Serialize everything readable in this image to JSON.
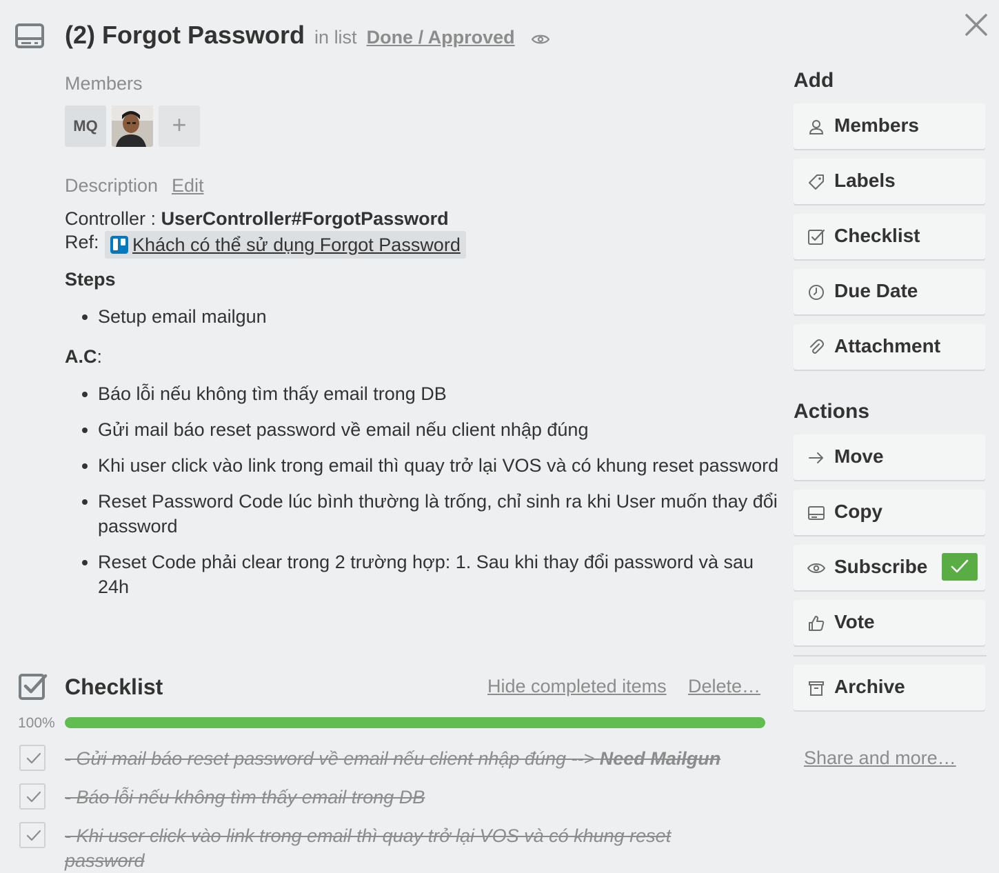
{
  "header": {
    "title": "(2) Forgot Password",
    "in_list_text": "in list",
    "list_name": "Done / Approved"
  },
  "members": {
    "label": "Members",
    "avatars": [
      {
        "initials": "MQ"
      },
      {
        "initials": ""
      }
    ],
    "add_symbol": "+"
  },
  "description": {
    "label": "Description",
    "edit_label": "Edit",
    "controller_prefix": "Controller : ",
    "controller_value": "UserController#ForgotPassword",
    "ref_prefix": "Ref:",
    "ref_link": "Khách có thể sử dụng Forgot Password",
    "steps_heading": "Steps",
    "steps": [
      "Setup email mailgun"
    ],
    "ac_heading": "A.C",
    "ac_colon": ":",
    "ac_items": [
      "Báo lỗi nếu không tìm thấy email trong DB",
      "Gửi mail báo reset password về email nếu client nhập đúng",
      "Khi user click vào link trong email thì quay trở lại VOS và có khung reset password",
      "Reset Password Code lúc bình thường là trống, chỉ sinh ra khi User muốn thay đổi password",
      "Reset Code phải clear trong 2 trường hợp: 1. Sau khi thay đổi password và sau 24h"
    ]
  },
  "checklist": {
    "title": "Checklist",
    "hide_completed": "Hide completed items",
    "delete": "Delete…",
    "progress_label": "100%",
    "progress": 1.0,
    "items": [
      {
        "text": "- Gửi mail báo reset password về email nếu client nhập đúng --> ",
        "bold_suffix": "Need Mailgun",
        "checked": true
      },
      {
        "text": "- Báo lỗi nếu không tìm thấy email trong DB",
        "bold_suffix": "",
        "checked": true
      },
      {
        "text": "- Khi user click vào link trong email thì quay trở lại VOS và có khung reset password",
        "bold_suffix": "",
        "checked": true
      }
    ]
  },
  "sidebar": {
    "add_heading": "Add",
    "add_buttons": [
      {
        "label": "Members",
        "icon": "person-icon"
      },
      {
        "label": "Labels",
        "icon": "tag-icon"
      },
      {
        "label": "Checklist",
        "icon": "checkbox-icon"
      },
      {
        "label": "Due Date",
        "icon": "clock-icon"
      },
      {
        "label": "Attachment",
        "icon": "paperclip-icon"
      }
    ],
    "actions_heading": "Actions",
    "action_buttons": [
      {
        "label": "Move",
        "icon": "arrow-right-icon"
      },
      {
        "label": "Copy",
        "icon": "card-icon"
      },
      {
        "label": "Subscribe",
        "icon": "eye-icon",
        "subscribed": true
      },
      {
        "label": "Vote",
        "icon": "thumbs-up-icon"
      },
      {
        "label": "Archive",
        "icon": "archive-icon"
      }
    ],
    "share_more": "Share and more…"
  },
  "colors": {
    "background": "#edeff0",
    "progress_green": "#61bd4f",
    "subscribe_green": "#5aac44",
    "muted_text": "#8c8c8c"
  }
}
